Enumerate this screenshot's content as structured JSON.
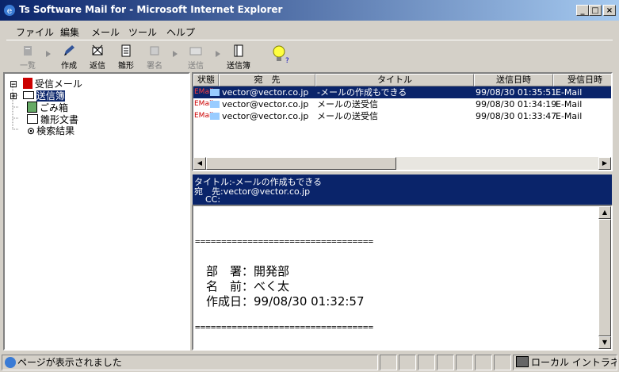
{
  "window": {
    "title": "Ts Software Mail for - Microsoft Internet Explorer",
    "minimize": "_",
    "maximize": "□",
    "close": "×"
  },
  "menu": [
    "ファイル",
    "編集",
    "メール",
    "ツール",
    "ヘルプ"
  ],
  "toolbar": {
    "list": "一覧",
    "compose": "作成",
    "reply": "返信",
    "template": "雛形",
    "sign": "署名",
    "send": "送信",
    "outbox": "送信簿"
  },
  "tree": [
    {
      "label": "受信メール",
      "expander": "⊟"
    },
    {
      "label": "送信簿",
      "expander": "⊞"
    },
    {
      "label": "ごみ箱"
    },
    {
      "label": "雛形文書"
    },
    {
      "label": "検索結果"
    }
  ],
  "list": {
    "columns": [
      "状態",
      "宛　先",
      "タイトル",
      "送信日時",
      "受信日時"
    ],
    "rows": [
      {
        "status": "EMail",
        "to": "vector@vector.co.jp",
        "title": "-メールの作成もできる",
        "sent": "99/08/30 01:35:51",
        "recv": "E-Mail"
      },
      {
        "status": "EMail",
        "to": "vector@vector.co.jp",
        "title": "メールの送受信",
        "sent": "99/08/30 01:34:19",
        "recv": "E-Mail"
      },
      {
        "status": "EMail",
        "to": "vector@vector.co.jp",
        "title": "メールの送受信",
        "sent": "99/08/30 01:33:47",
        "recv": "E-Mail"
      }
    ]
  },
  "preview": {
    "title_line": "タイトル:-メールの作成もできる",
    "to_line": "宛　先:vector@vector.co.jp",
    "cc_line": "CC:",
    "sep": "==================================",
    "dept": "部　署：開発部",
    "name": "名　前：べく太",
    "date": "作成日：99/08/30 01:32:57",
    "sep2": "=================================="
  },
  "status": {
    "text": "ページが表示されました",
    "zone": "ローカル イントラネッ"
  },
  "colors": {
    "selection": "#0a246a",
    "chrome": "#d4d0c8"
  }
}
